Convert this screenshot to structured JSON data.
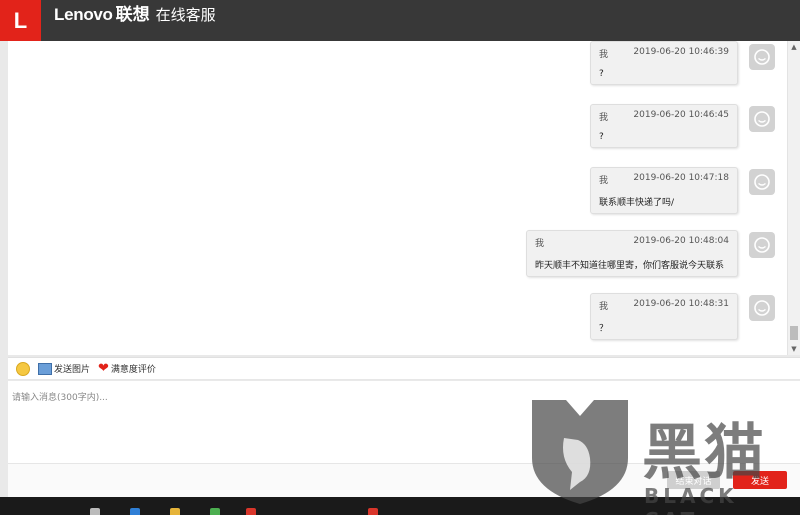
{
  "header": {
    "logo_letter": "L",
    "brand_en": "Lenovo",
    "brand_cn": "联想",
    "service_title": "在线客服"
  },
  "messages": [
    {
      "sender": "我",
      "time": "2019-06-20 10:46:39",
      "text": "?"
    },
    {
      "sender": "我",
      "time": "2019-06-20 10:46:45",
      "text": "?"
    },
    {
      "sender": "我",
      "time": "2019-06-20 10:47:18",
      "text": "联系顺丰快递了吗/"
    },
    {
      "sender": "我",
      "time": "2019-06-20 10:48:04",
      "text": "昨天顺丰不知道往哪里寄，你们客服说今天联系"
    },
    {
      "sender": "我",
      "time": "2019-06-20 10:48:31",
      "text": "？"
    }
  ],
  "toolbar": {
    "send_image": "发送图片",
    "rating": "满意度评价"
  },
  "input": {
    "placeholder": "请输入消息(300字内)..."
  },
  "buttons": {
    "end_chat": "结束对话",
    "send": "发送"
  },
  "watermark": {
    "title": "黑猫",
    "subtitle": "BLACK CAT"
  },
  "colors": {
    "accent": "#e2231a",
    "header_bg": "#383838"
  }
}
